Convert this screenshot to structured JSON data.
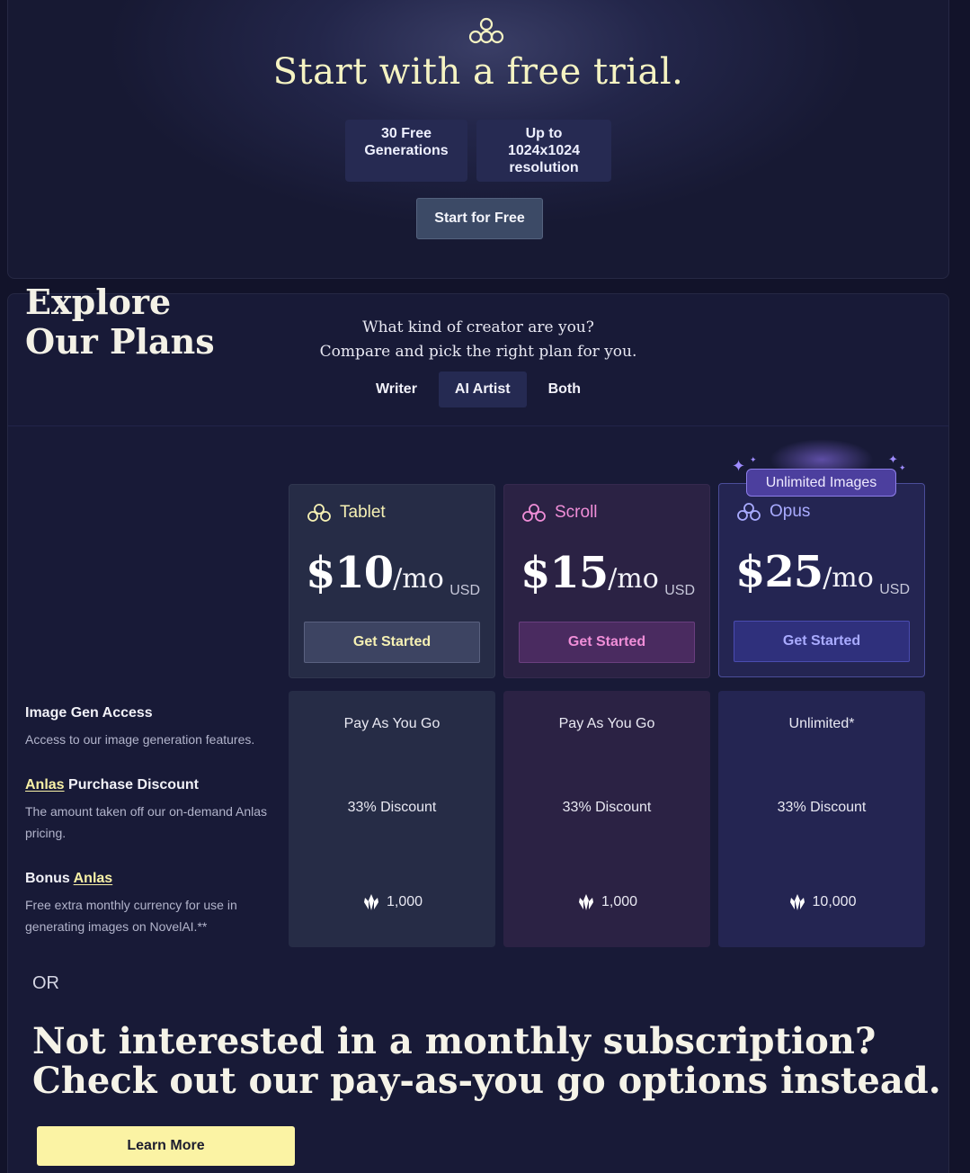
{
  "hero": {
    "title": "Start with a free trial.",
    "badges": [
      {
        "line1": "30 Free",
        "line2": "Generations"
      },
      {
        "line1": "Up to 1024x1024",
        "line2": "resolution"
      }
    ],
    "cta": "Start for Free"
  },
  "plans_section": {
    "question_line1": "What kind of creator are you?",
    "question_line2": "Compare and pick the right plan for you.",
    "tabs": [
      {
        "label": "Writer",
        "active": false
      },
      {
        "label": "AI Artist",
        "active": true
      },
      {
        "label": "Both",
        "active": false
      }
    ],
    "explore_line1": "Explore",
    "explore_line2": "Our Plans",
    "features": [
      {
        "name": "Image Gen Access",
        "desc": "Access to our image generation features."
      },
      {
        "name_link": "Anlas",
        "name_rest": " Purchase Discount",
        "desc": "The amount taken off our on-demand Anlas pricing."
      },
      {
        "name_prefix": "Bonus ",
        "name_link": "Anlas",
        "desc": "Free extra monthly currency for use in generating images on NovelAI.**"
      }
    ],
    "featured_badge": "Unlimited Images",
    "plans": [
      {
        "name": "Tablet",
        "price": "$10",
        "per": "/mo",
        "currency": "USD",
        "cta": "Get Started",
        "name_color": "#f6f1b4",
        "image_gen": "Pay As You Go",
        "discount": "33% Discount",
        "bonus": "1,000"
      },
      {
        "name": "Scroll",
        "price": "$15",
        "per": "/mo",
        "currency": "USD",
        "cta": "Get Started",
        "name_color": "#f08ed8",
        "image_gen": "Pay As You Go",
        "discount": "33% Discount",
        "bonus": "1,000"
      },
      {
        "name": "Opus",
        "price": "$25",
        "per": "/mo",
        "currency": "USD",
        "cta": "Get Started",
        "name_color": "#a9abff",
        "image_gen": "Unlimited*",
        "discount": "33% Discount",
        "bonus": "10,000"
      }
    ],
    "or_label": "OR",
    "payg_line1": "Not interested in a monthly subscription?",
    "payg_line2": "Check out our pay-as-you go options instead.",
    "learn_more": "Learn More"
  },
  "icons": {
    "logo": "novelai-logo-icon",
    "plan": "plan-cloud-icon",
    "anlas": "anlas-crystal-icon"
  }
}
